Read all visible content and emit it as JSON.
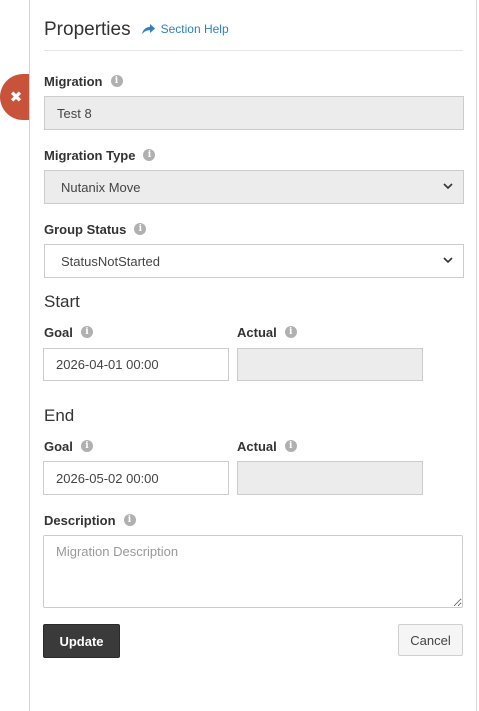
{
  "panel": {
    "title": "Properties",
    "help_label": "Section Help"
  },
  "migration": {
    "label": "Migration",
    "value": "Test 8"
  },
  "migration_type": {
    "label": "Migration Type",
    "value": "Nutanix Move"
  },
  "group_status": {
    "label": "Group Status",
    "value": "StatusNotStarted"
  },
  "start": {
    "heading": "Start",
    "goal_label": "Goal",
    "goal_value": "2026-04-01 00:00",
    "actual_label": "Actual",
    "actual_value": ""
  },
  "end": {
    "heading": "End",
    "goal_label": "Goal",
    "goal_value": "2026-05-02 00:00",
    "actual_label": "Actual",
    "actual_value": ""
  },
  "description": {
    "label": "Description",
    "placeholder": "Migration Description",
    "value": ""
  },
  "actions": {
    "update_label": "Update",
    "cancel_label": "Cancel"
  },
  "icons": {
    "close": "close-icon",
    "help": "share-arrow-icon",
    "info": "info-icon",
    "dropdown": "chevron-down-icon"
  },
  "colors": {
    "close_button": "#c9533a",
    "help_link": "#2f7fc1",
    "primary_button": "#3a3a3a",
    "disabled_field": "#ececec"
  }
}
